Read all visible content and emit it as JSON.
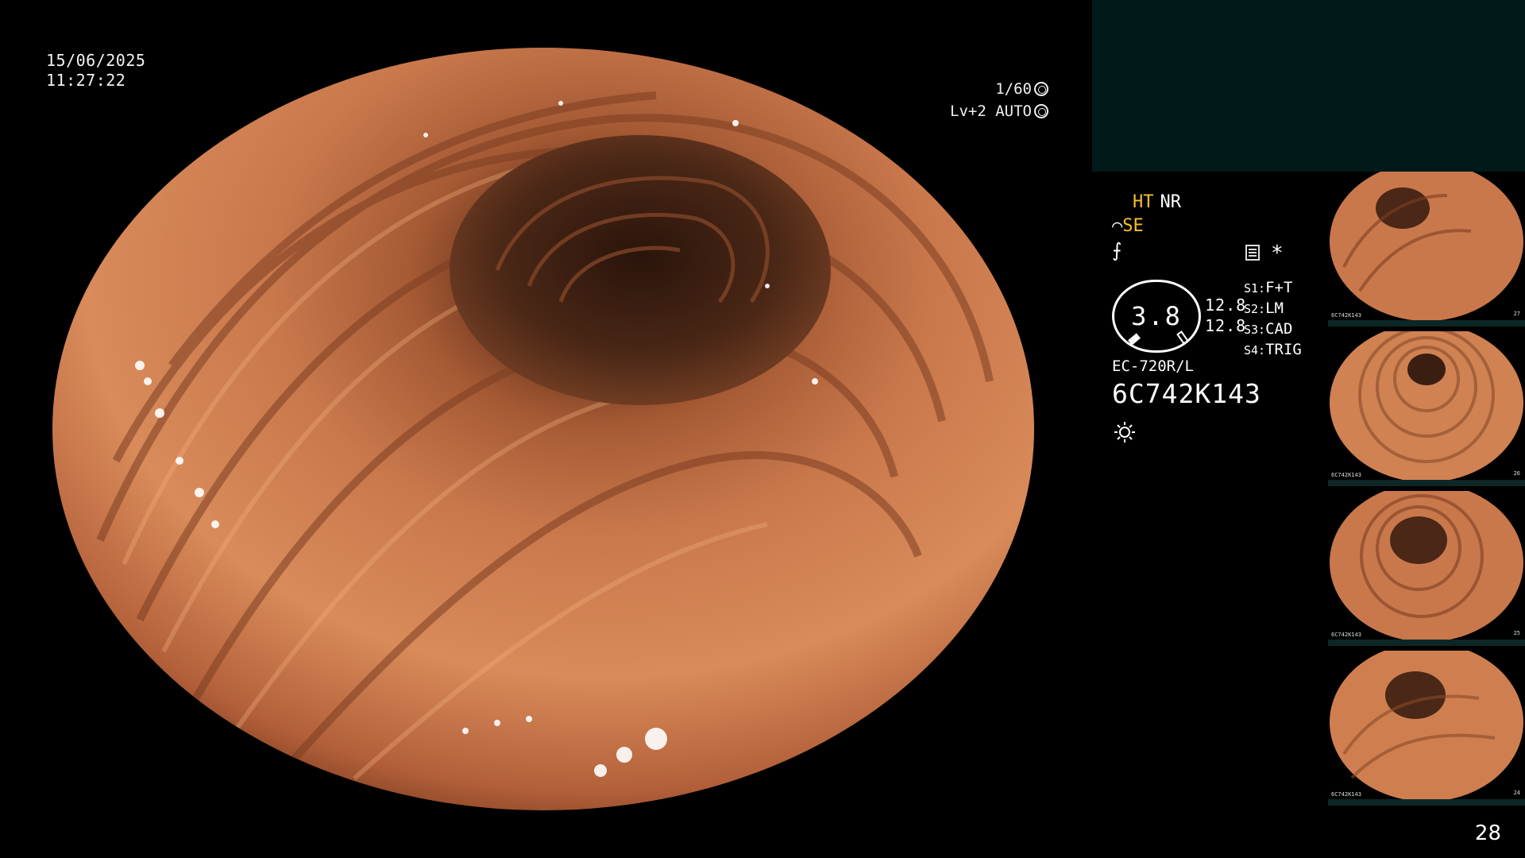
{
  "datetime": {
    "date": "15/06/2025",
    "time": "11:27:22"
  },
  "shutter": {
    "speed": "1/60",
    "level": "Lv+2 AUTO"
  },
  "settings": {
    "ht": "HT",
    "nr": "NR",
    "se_symbol": "⌒",
    "se": "SE",
    "ff_symbol": "⨍",
    "memo_icon": "memo-icon",
    "star": "*",
    "gauge_value": "3.8",
    "gauge_side": [
      "12.8",
      "12.8"
    ],
    "slots": [
      {
        "key": "S1:",
        "value": "F+T"
      },
      {
        "key": "S2:",
        "value": "LM"
      },
      {
        "key": "S3:",
        "value": "CAD"
      },
      {
        "key": "S4:",
        "value": "TRIG"
      }
    ],
    "scope_model": "EC-720R/L",
    "serial": "6C742K143"
  },
  "thumbnails": [
    {
      "serial": "6C742K143",
      "num": "27"
    },
    {
      "serial": "6C742K143",
      "num": "26"
    },
    {
      "serial": "6C742K143",
      "num": "25"
    },
    {
      "serial": "6C742K143",
      "num": "24"
    }
  ],
  "page_number": "28",
  "colors": {
    "overlay_yellow": "#f6c02a",
    "panel_teal": "#001a1a",
    "tissue": "#c8744a"
  }
}
